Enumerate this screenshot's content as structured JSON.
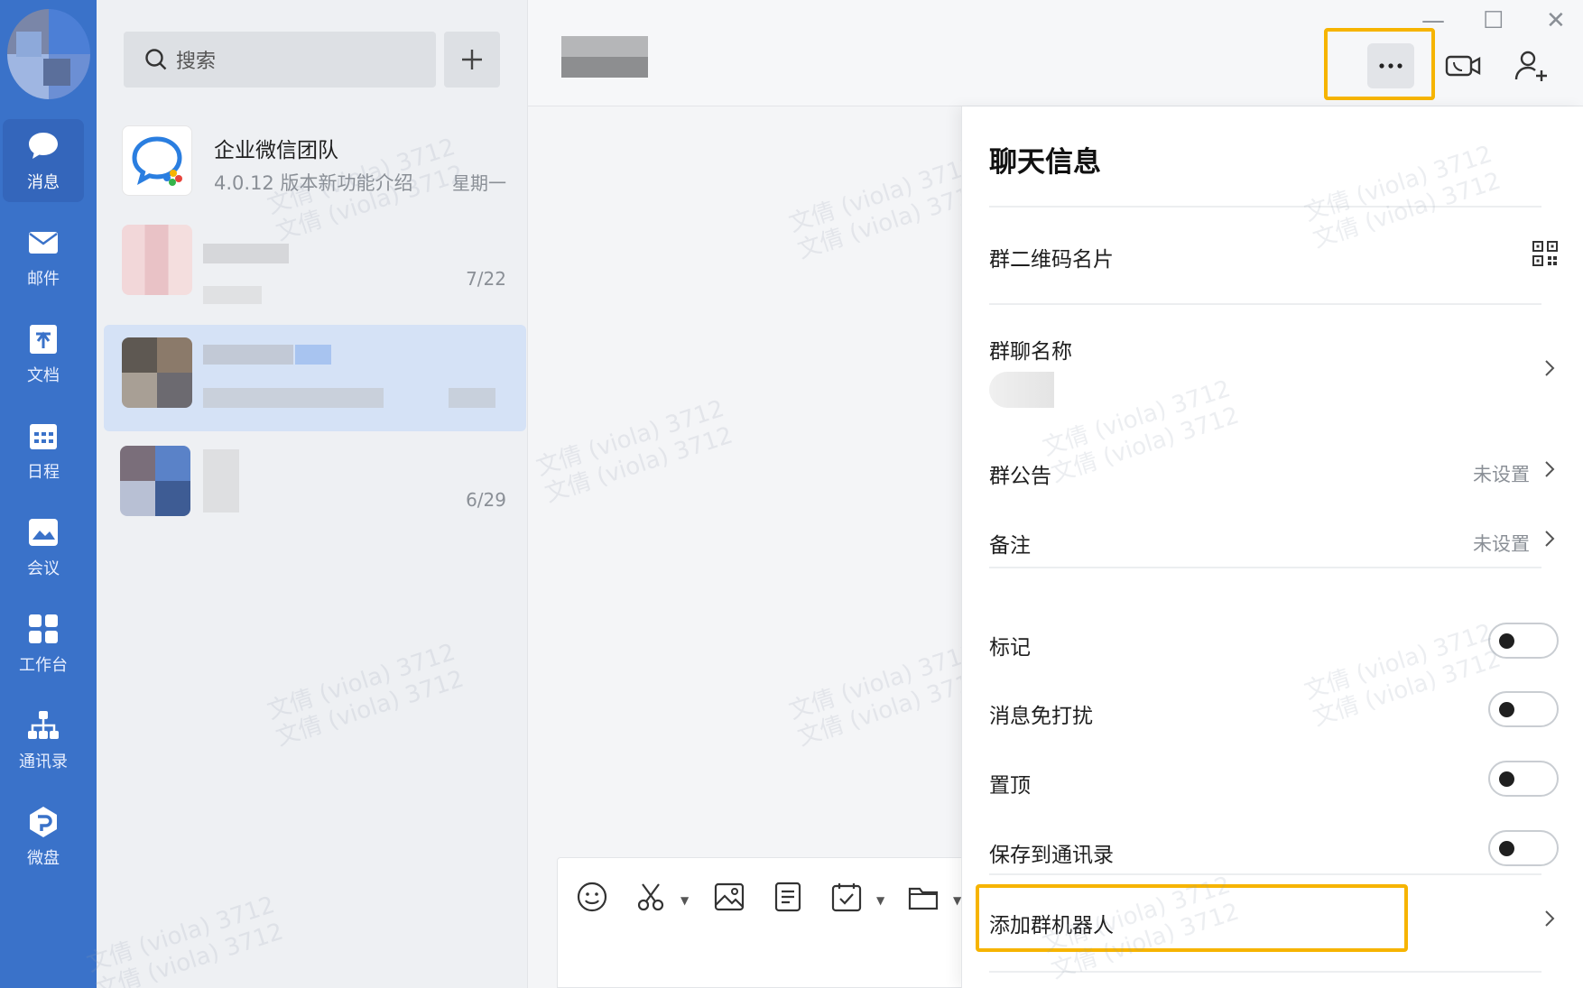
{
  "nav": {
    "items": [
      {
        "label": "消息",
        "icon": "chat-bubble-icon",
        "active": true
      },
      {
        "label": "邮件",
        "icon": "mail-icon",
        "active": false
      },
      {
        "label": "文档",
        "icon": "document-icon",
        "active": false
      },
      {
        "label": "日程",
        "icon": "calendar-icon",
        "active": false
      },
      {
        "label": "会议",
        "icon": "meeting-icon",
        "active": false
      },
      {
        "label": "工作台",
        "icon": "workbench-icon",
        "active": false
      },
      {
        "label": "通讯录",
        "icon": "contacts-icon",
        "active": false
      },
      {
        "label": "微盘",
        "icon": "drive-icon",
        "active": false
      }
    ]
  },
  "list": {
    "search_placeholder": "搜索",
    "conversations": [
      {
        "name": "企业微信团队",
        "preview": "4.0.12 版本新功能介绍",
        "time": "星期一"
      },
      {
        "name": "",
        "preview": "",
        "time": "7/22"
      },
      {
        "name": "",
        "preview": "",
        "time": ""
      },
      {
        "name": "",
        "preview": "",
        "time": "6/29"
      }
    ]
  },
  "panel": {
    "title": "聊天信息",
    "rows": {
      "qr": "群二维码名片",
      "group_name": "群聊名称",
      "announcement": "群公告",
      "announcement_value": "未设置",
      "remark": "备注",
      "remark_value": "未设置",
      "mark": "标记",
      "mute": "消息免打扰",
      "pin": "置顶",
      "save_contacts": "保存到通讯录",
      "add_robot": "添加群机器人"
    }
  },
  "colors": {
    "rail": "#3a72c9",
    "highlight": "#f6b400",
    "selected_conv": "#d5e2f6"
  }
}
